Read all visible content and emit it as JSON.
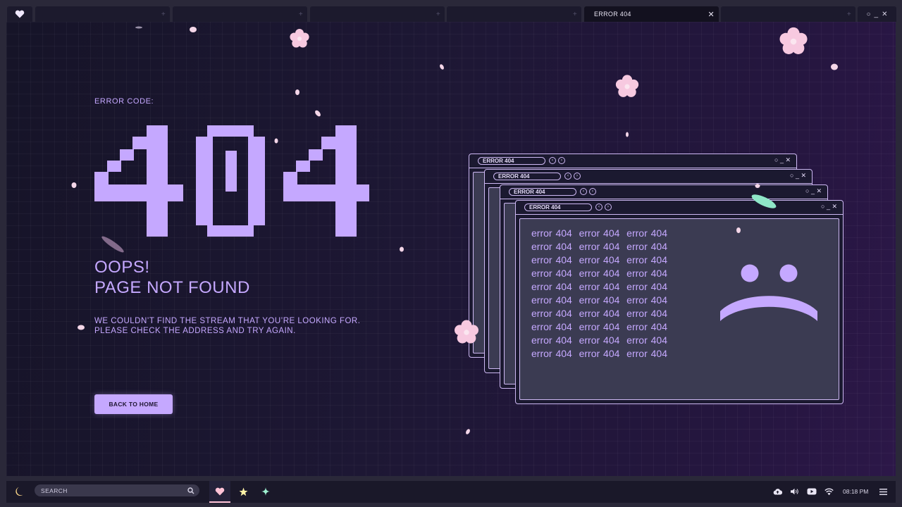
{
  "tabs": [
    {
      "label": "",
      "active": false
    },
    {
      "label": "",
      "active": false
    },
    {
      "label": "",
      "active": false
    },
    {
      "label": "",
      "active": false
    },
    {
      "label": "ERROR 404",
      "active": true
    },
    {
      "label": "",
      "active": false
    }
  ],
  "window_controls": {
    "maximize": "○",
    "minimize": "_",
    "close": "✕"
  },
  "page": {
    "error_label": "ERROR CODE:",
    "error_code": "404",
    "headline_line1": "OOPS!",
    "headline_line2": "PAGE NOT FOUND",
    "description_line1": "WE COULDN’T FIND THE STREAM THAT YOU’RE LOOKING FOR.",
    "description_line2": "PLEASE CHECK THE ADDRESS AND TRY AGAIN.",
    "home_button": "BACK TO HOME"
  },
  "error_windows": {
    "title": "ERROR 404",
    "controls": "○ _ ✕",
    "repeated_text": "error 404  error 404  error 404",
    "line_count": 10
  },
  "taskbar": {
    "search_placeholder": "SEARCH",
    "time": "08:18 PM",
    "pinned_icons": [
      "heart-icon",
      "star-icon",
      "sparkle-icon"
    ],
    "tray_icons": [
      "cloud-upload-icon",
      "volume-icon",
      "youtube-icon",
      "wifi-icon",
      "menu-icon"
    ]
  },
  "colors": {
    "accent": "#c5a8ff",
    "tab_active_bg": "#13111f",
    "window_border": "#cdb8f3",
    "window_body": "#3b3b52",
    "petal": "#f7c9e0"
  }
}
